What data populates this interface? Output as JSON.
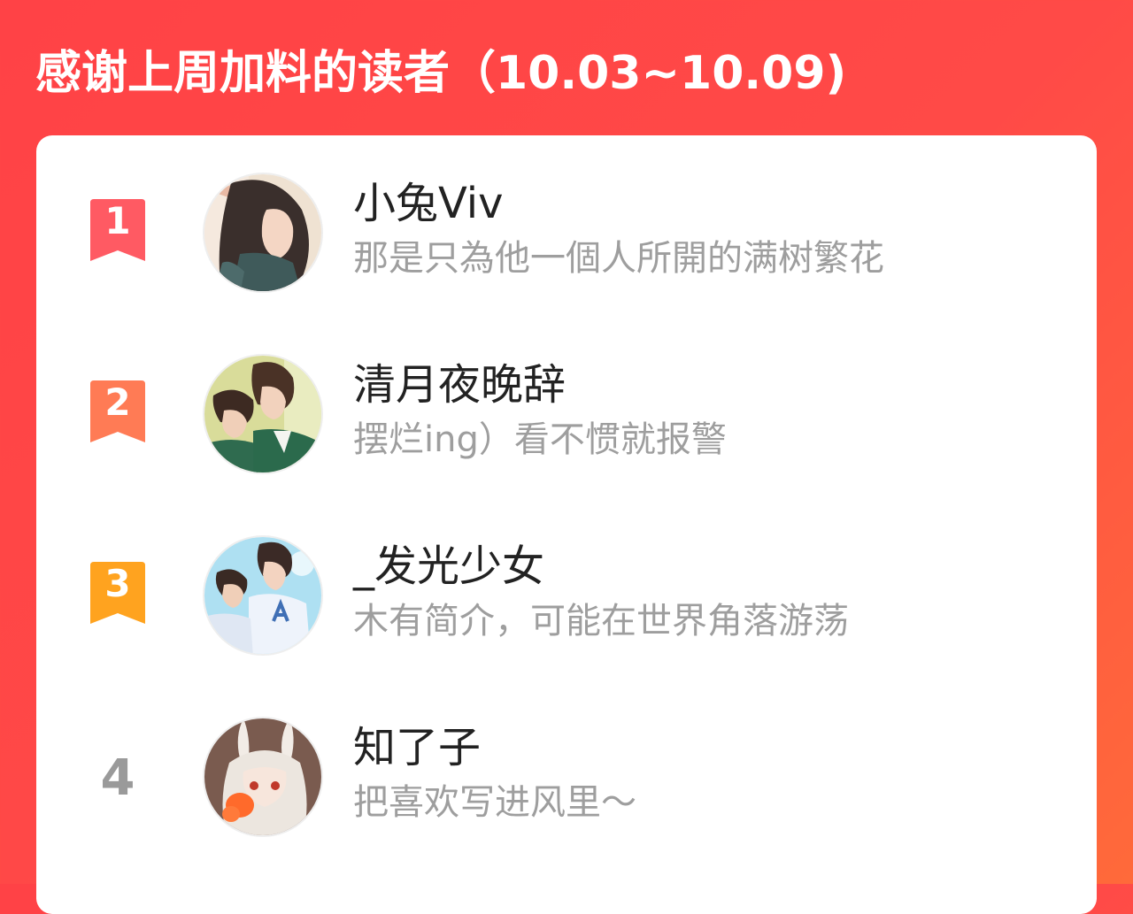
{
  "header": {
    "title": "感谢上周加料的读者（10.03~10.09)"
  },
  "colors": {
    "background_start": "#ff4246",
    "background_end": "#ff6a3a",
    "rank1": "#ff5a63",
    "rank2": "#ff7b55",
    "rank3": "#ffa31f",
    "rank_plain": "#9a9a9a"
  },
  "readers": [
    {
      "rank": "1",
      "name": "小兔Viv",
      "bio": "那是只為他一個人所開的满树繁花",
      "avatar_icon": "avatar-long-hair-girl"
    },
    {
      "rank": "2",
      "name": "清月夜晚辞",
      "bio": "摆烂ing）看不惯就报警",
      "avatar_icon": "avatar-two-boys-uniform"
    },
    {
      "rank": "3",
      "name": "_发光少女",
      "bio": "木有简介，可能在世界角落游荡",
      "avatar_icon": "avatar-two-boys-sky"
    },
    {
      "rank": "4",
      "name": "知了子",
      "bio": "把喜欢写进风里～",
      "avatar_icon": "avatar-bunny-ears-girl"
    }
  ]
}
